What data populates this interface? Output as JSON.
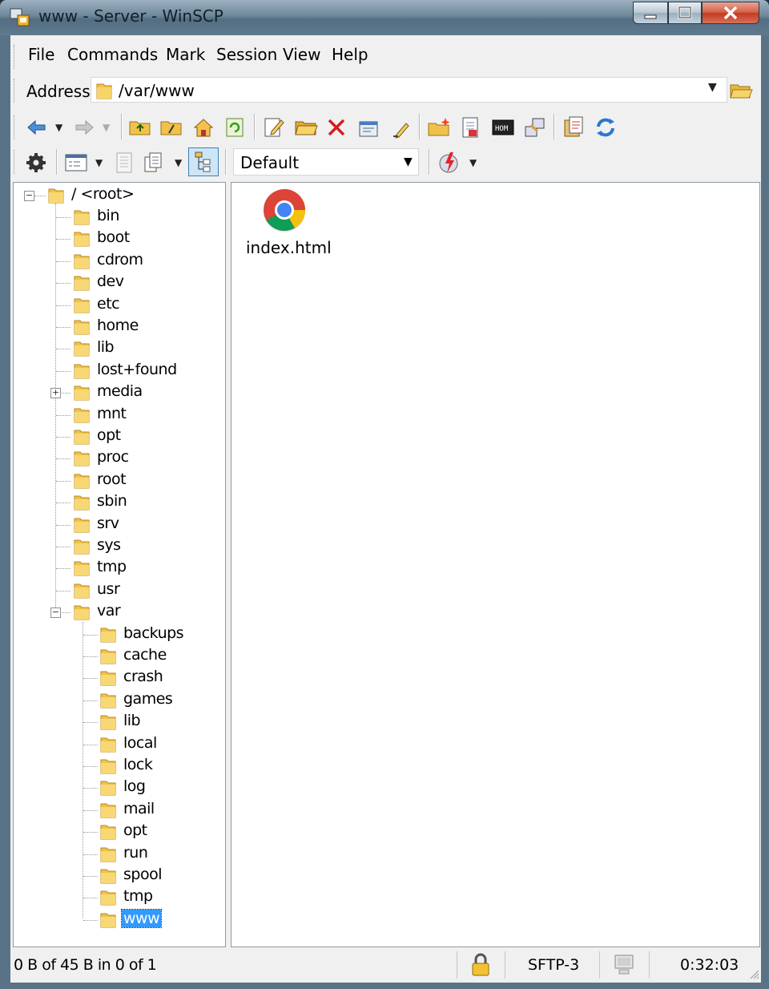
{
  "window": {
    "title": "www - Server - WinSCP"
  },
  "menu": [
    "File",
    "Commands",
    "Mark",
    "Session",
    "View",
    "Help"
  ],
  "address": {
    "label": "Address",
    "value": "/var/www"
  },
  "toolbar2": {
    "profile": "Default"
  },
  "tree": {
    "root_label": "/ <root>",
    "root_children": [
      "bin",
      "boot",
      "cdrom",
      "dev",
      "etc",
      "home",
      "lib",
      "lost+found",
      "media",
      "mnt",
      "opt",
      "proc",
      "root",
      "sbin",
      "srv",
      "sys",
      "tmp",
      "usr",
      "var"
    ],
    "var_children": [
      "backups",
      "cache",
      "crash",
      "games",
      "lib",
      "local",
      "lock",
      "log",
      "mail",
      "opt",
      "run",
      "spool",
      "tmp",
      "www"
    ],
    "selected": "www"
  },
  "files": [
    {
      "name": "index.html",
      "icon": "chrome-icon"
    }
  ],
  "status": {
    "selection": "0 B of 45 B in 0 of 1",
    "protocol": "SFTP-3",
    "elapsed": "0:32:03"
  },
  "colors": {
    "selection": "#3399ff",
    "folder": "#f1c24b",
    "title_bar": "#6d879a"
  }
}
